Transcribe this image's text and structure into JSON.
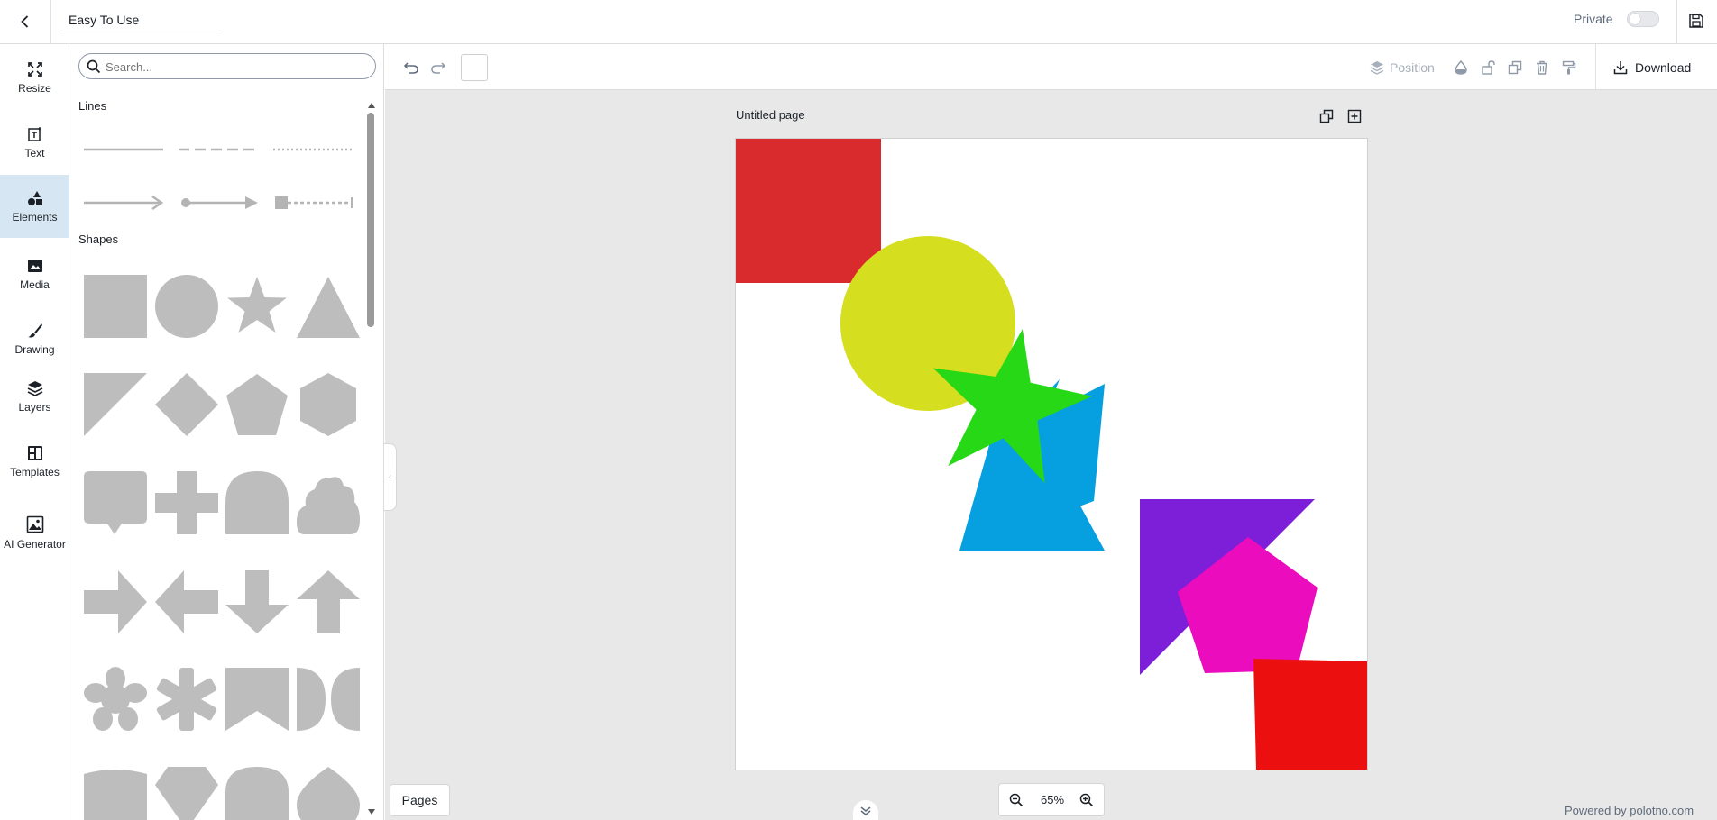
{
  "header": {
    "design_name": "Easy To Use",
    "private_label": "Private",
    "private_enabled": false
  },
  "side_tabs": [
    {
      "label": "Resize",
      "icon": "fullscreen-icon"
    },
    {
      "label": "Text",
      "icon": "text-icon"
    },
    {
      "label": "Elements",
      "icon": "shapes-icon",
      "active": true
    },
    {
      "label": "Media",
      "icon": "image-icon"
    },
    {
      "label": "Drawing",
      "icon": "brush-icon"
    },
    {
      "label": "Layers",
      "icon": "layers-icon"
    },
    {
      "label": "Templates",
      "icon": "templates-icon"
    },
    {
      "label": "AI Generator",
      "icon": "ai-image-icon"
    }
  ],
  "panel": {
    "search_placeholder": "Search...",
    "lines_title": "Lines",
    "shapes_title": "Shapes",
    "lines": [
      "solid-line",
      "dashed-line",
      "dotted-line",
      "arrow-line",
      "dot-arrow-line",
      "square-dashed-line"
    ],
    "shapes": [
      "rectangle",
      "circle",
      "star",
      "triangle",
      "right-triangle",
      "diamond",
      "pentagon",
      "hexagon",
      "speech-bubble",
      "cross",
      "arch",
      "cloud",
      "arrow-right",
      "arrow-left",
      "arrow-down",
      "arrow-up",
      "flower",
      "asterisk",
      "bookmark",
      "half-circles",
      "cylinder",
      "gem",
      "dome",
      "drop"
    ]
  },
  "toolbar": {
    "position_label": "Position",
    "download_label": "Download",
    "fill_color": "#ffffff"
  },
  "page": {
    "title": "Untitled page",
    "elements": [
      "red-square",
      "yellow-circle",
      "green-star",
      "blue-triangle",
      "purple-triangle",
      "pink-pentagon",
      "red-square"
    ],
    "colors": {
      "red_square_top": "#d92b2e",
      "yellow_circle": "#d5de1f",
      "green_star": "#27d816",
      "blue_triangle": "#069fe0",
      "purple_triangle": "#7d1fd9",
      "pink_pentagon": "#eb0cbd",
      "red_square_bottom": "#ec0f0f"
    }
  },
  "footer": {
    "pages_label": "Pages",
    "zoom_label": "65%",
    "powered_by": "Powered by polotno.com"
  }
}
